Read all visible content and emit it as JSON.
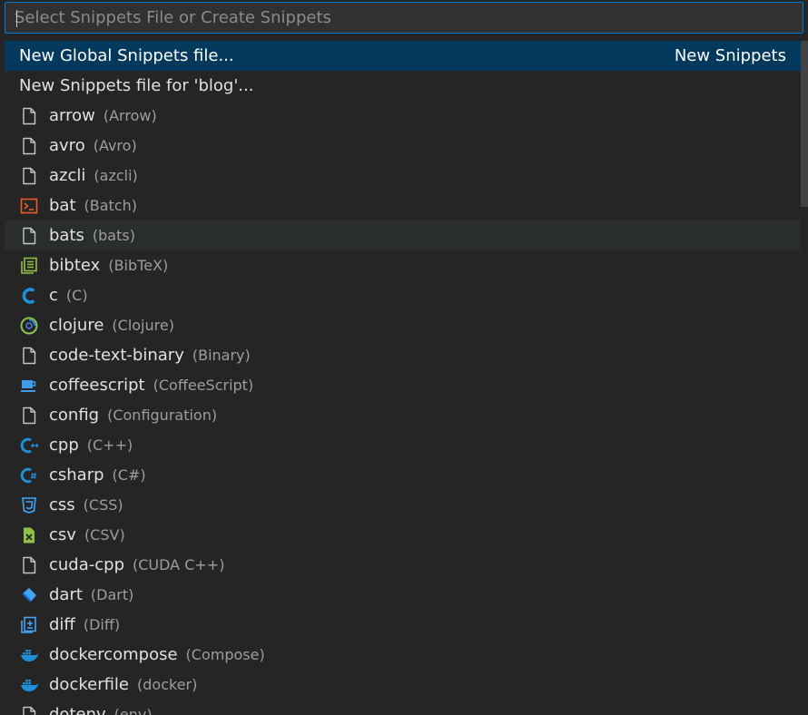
{
  "search": {
    "placeholder": "Select Snippets File or Create Snippets",
    "value": ""
  },
  "colors": {
    "selection": "#04395e",
    "hover": "#2a2d2e",
    "focus_border": "#0078d4"
  },
  "actions": [
    {
      "label": "New Global Snippets file...",
      "hint": "New Snippets"
    },
    {
      "label": "New Snippets file for 'blog'..."
    }
  ],
  "languages": [
    {
      "id": "arrow",
      "name": "(Arrow)",
      "icon": "file-icon"
    },
    {
      "id": "avro",
      "name": "(Avro)",
      "icon": "file-icon"
    },
    {
      "id": "azcli",
      "name": "(azcli)",
      "icon": "file-icon"
    },
    {
      "id": "bat",
      "name": "(Batch)",
      "icon": "terminal-icon"
    },
    {
      "id": "bats",
      "name": "(bats)",
      "icon": "file-icon"
    },
    {
      "id": "bibtex",
      "name": "(BibTeX)",
      "icon": "bibtex-icon"
    },
    {
      "id": "c",
      "name": "(C)",
      "icon": "c-icon"
    },
    {
      "id": "clojure",
      "name": "(Clojure)",
      "icon": "clojure-icon"
    },
    {
      "id": "code-text-binary",
      "name": "(Binary)",
      "icon": "file-icon"
    },
    {
      "id": "coffeescript",
      "name": "(CoffeeScript)",
      "icon": "coffee-icon"
    },
    {
      "id": "config",
      "name": "(Configuration)",
      "icon": "file-icon"
    },
    {
      "id": "cpp",
      "name": "(C++)",
      "icon": "cpp-icon"
    },
    {
      "id": "csharp",
      "name": "(C#)",
      "icon": "csharp-icon"
    },
    {
      "id": "css",
      "name": "(CSS)",
      "icon": "css-icon"
    },
    {
      "id": "csv",
      "name": "(CSV)",
      "icon": "csv-icon"
    },
    {
      "id": "cuda-cpp",
      "name": "(CUDA C++)",
      "icon": "file-icon"
    },
    {
      "id": "dart",
      "name": "(Dart)",
      "icon": "dart-icon"
    },
    {
      "id": "diff",
      "name": "(Diff)",
      "icon": "diff-icon"
    },
    {
      "id": "dockercompose",
      "name": "(Compose)",
      "icon": "docker-icon"
    },
    {
      "id": "dockerfile",
      "name": "(docker)",
      "icon": "docker-icon"
    },
    {
      "id": "dotenv",
      "name": "(env)",
      "icon": "file-icon"
    }
  ]
}
